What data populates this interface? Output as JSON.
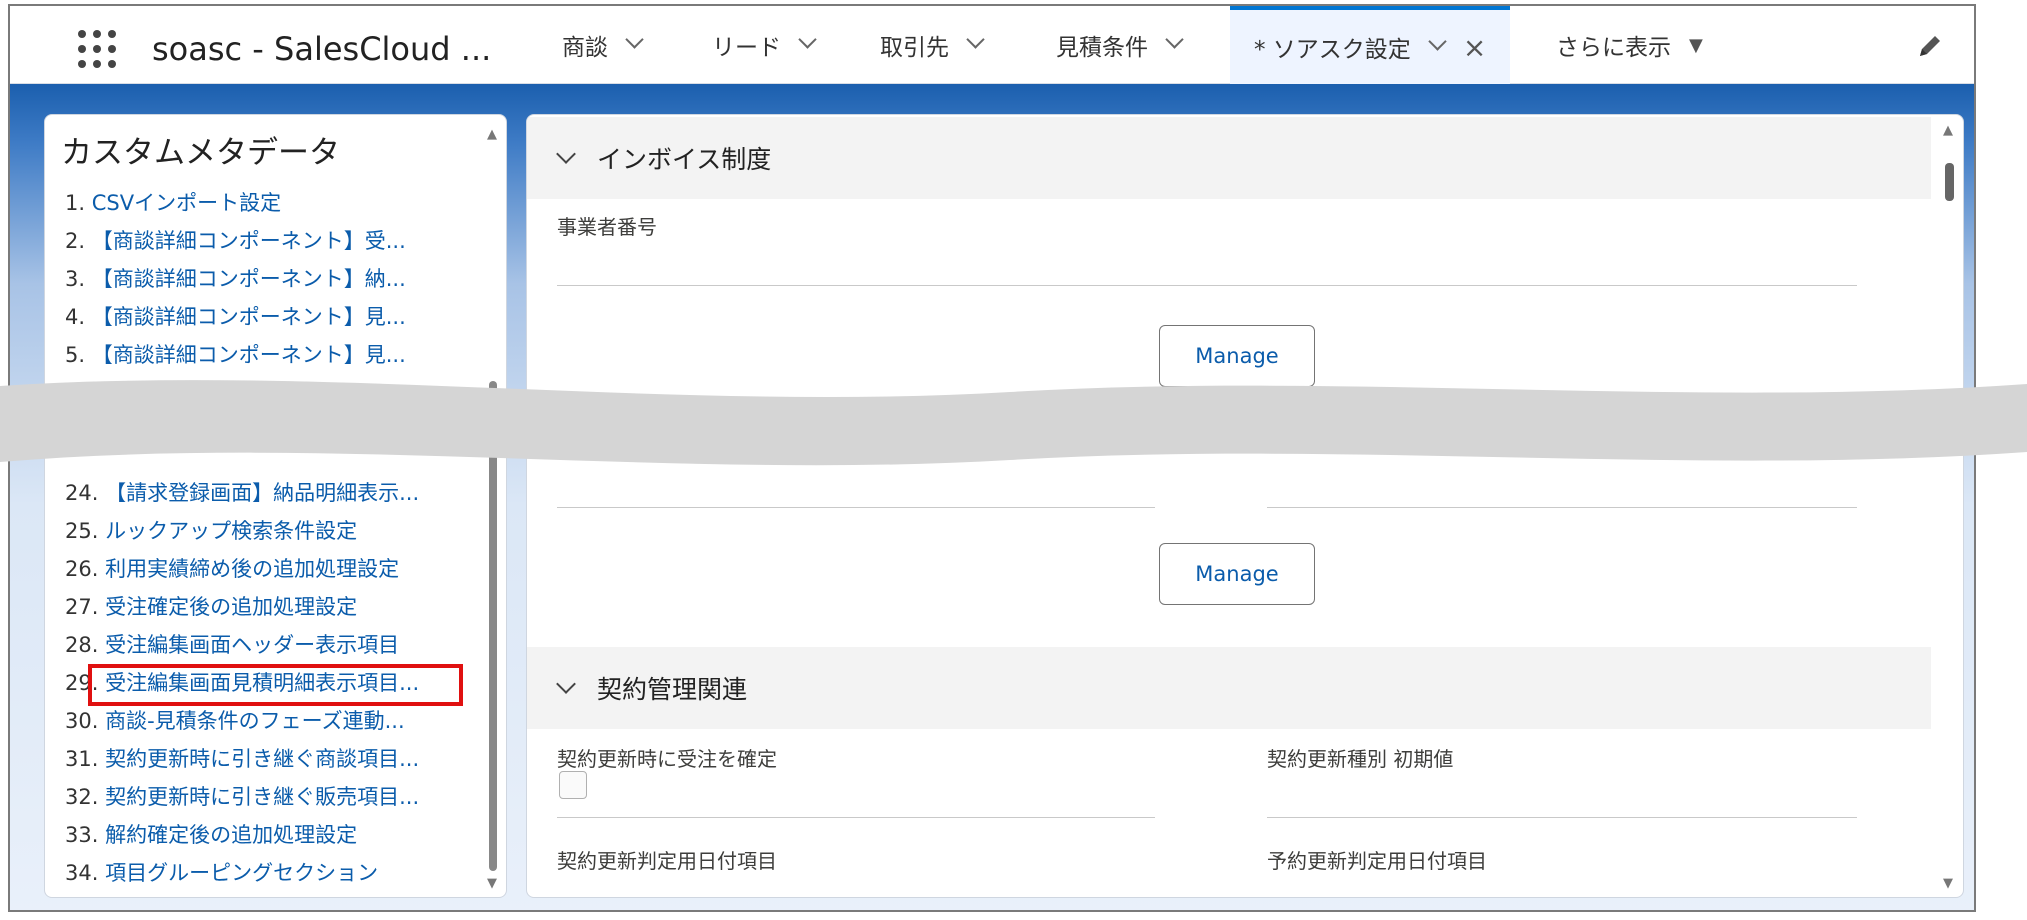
{
  "app": {
    "title": "soasc - SalesCloud ..."
  },
  "tabs": [
    {
      "label": "商談"
    },
    {
      "label": "リード"
    },
    {
      "label": "取引先"
    },
    {
      "label": "見積条件"
    },
    {
      "label": "* ソアスク設定"
    },
    {
      "label": "さらに表示"
    }
  ],
  "icons": {
    "launcher": "app-launcher-icon",
    "edit": "pencil-icon",
    "close": "close-icon",
    "dropdown": "chevron-down-icon"
  },
  "colors": {
    "accent": "#0176d3",
    "link": "#0b5cab",
    "highlight": "#e01010"
  },
  "left_panel": {
    "title": "カスタムメタデータ",
    "items_top": [
      {
        "num": "1.",
        "label": "CSVインポート設定"
      },
      {
        "num": "2.",
        "label": "【商談詳細コンポーネント】受..."
      },
      {
        "num": "3.",
        "label": "【商談詳細コンポーネント】納..."
      },
      {
        "num": "4.",
        "label": "【商談詳細コンポーネント】見..."
      },
      {
        "num": "5.",
        "label": "【商談詳細コンポーネント】見..."
      }
    ],
    "items_bottom": [
      {
        "num": "24.",
        "label": "【請求登録画面】納品明細表示..."
      },
      {
        "num": "25.",
        "label": "ルックアップ検索条件設定"
      },
      {
        "num": "26.",
        "label": "利用実績締め後の追加処理設定"
      },
      {
        "num": "27.",
        "label": "受注確定後の追加処理設定"
      },
      {
        "num": "28.",
        "label": "受注編集画面ヘッダー表示項目"
      },
      {
        "num": "29.",
        "label": "受注編集画面見積明細表示項目..."
      },
      {
        "num": "30.",
        "label": "商談-見積条件のフェーズ連動..."
      },
      {
        "num": "31.",
        "label": "契約更新時に引き継ぐ商談項目..."
      },
      {
        "num": "32.",
        "label": "契約更新時に引き継ぐ販売項目..."
      },
      {
        "num": "33.",
        "label": "解約確定後の追加処理設定"
      },
      {
        "num": "34.",
        "label": "項目グルーピングセクション"
      }
    ]
  },
  "right_panel": {
    "section_invoice": {
      "title": "インボイス制度",
      "field_label": "事業者番号",
      "manage_label": "Manage"
    },
    "manage_label_2": "Manage",
    "section_contract": {
      "title": "契約管理関連",
      "fields": [
        {
          "label": "契約更新時に受注を確定"
        },
        {
          "label": "契約更新種別 初期値"
        },
        {
          "label": "契約更新判定用日付項目"
        },
        {
          "label": "予約更新判定用日付項目"
        }
      ]
    }
  }
}
